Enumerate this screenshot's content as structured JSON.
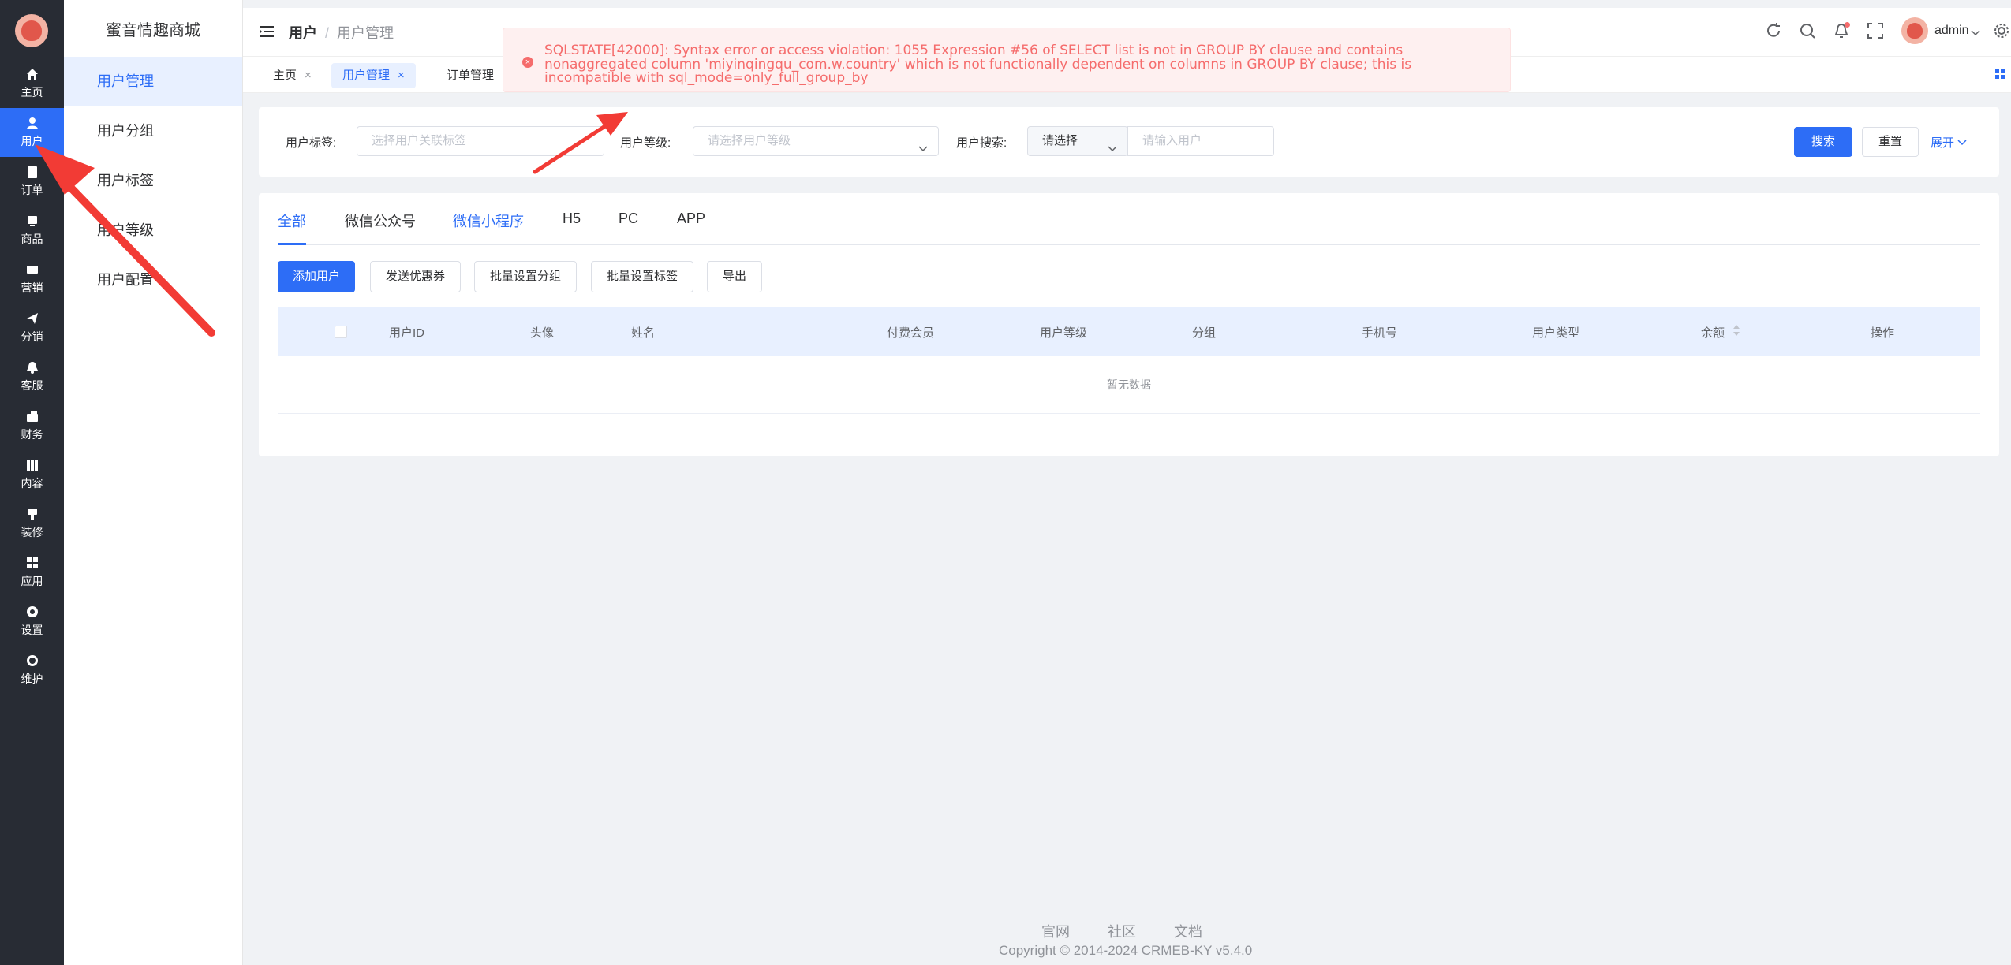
{
  "rail": {
    "items": [
      {
        "label": "主页",
        "icon": "home-icon"
      },
      {
        "label": "用户",
        "icon": "user-icon",
        "active": true
      },
      {
        "label": "订单",
        "icon": "order-icon"
      },
      {
        "label": "商品",
        "icon": "goods-icon"
      },
      {
        "label": "营销",
        "icon": "marketing-icon"
      },
      {
        "label": "分销",
        "icon": "send-icon"
      },
      {
        "label": "客服",
        "icon": "bell-icon"
      },
      {
        "label": "财务",
        "icon": "finance-icon"
      },
      {
        "label": "内容",
        "icon": "content-icon"
      },
      {
        "label": "装修",
        "icon": "brush-icon"
      },
      {
        "label": "应用",
        "icon": "apps-icon"
      },
      {
        "label": "设置",
        "icon": "gear-icon"
      },
      {
        "label": "维护",
        "icon": "maintain-icon"
      }
    ]
  },
  "submenu": {
    "brand": "蜜音情趣商城",
    "items": [
      {
        "label": "用户管理",
        "active": true
      },
      {
        "label": "用户分组"
      },
      {
        "label": "用户标签"
      },
      {
        "label": "用户等级"
      },
      {
        "label": "用户配置"
      }
    ]
  },
  "header": {
    "crumb_1": "用户",
    "crumb_sep": "/",
    "crumb_2": "用户管理",
    "user": "admin"
  },
  "tabstrip": {
    "tags": [
      {
        "label": "主页",
        "close": "×"
      },
      {
        "label": "用户管理",
        "close": "×",
        "active": true
      },
      {
        "label": "订单管理"
      }
    ]
  },
  "toast": {
    "icon": "error-icon",
    "message": "SQLSTATE[42000]: Syntax error or access violation: 1055 Expression #56 of SELECT list is not in GROUP BY clause and contains nonaggregated column 'miyinqingqu_com.w.country' which is not functionally dependent on columns in GROUP BY clause; this is incompatible with sql_mode=only_full_group_by"
  },
  "filter": {
    "tag_label": "用户标签:",
    "tag_placeholder": "选择用户关联标签",
    "level_label": "用户等级:",
    "level_placeholder": "请选择用户等级",
    "search_label": "用户搜索:",
    "search_type": "请选择",
    "search_placeholder": "请输入用户",
    "search_button": "搜索",
    "reset_button": "重置",
    "expand_link": "展开"
  },
  "main": {
    "tabs": [
      "全部",
      "微信公众号",
      "微信小程序",
      "H5",
      "PC",
      "APP"
    ],
    "actions": [
      "添加用户",
      "发送优惠券",
      "批量设置分组",
      "批量设置标签",
      "导出"
    ],
    "columns": [
      "用户ID",
      "头像",
      "姓名",
      "付费会员",
      "用户等级",
      "分组",
      "手机号",
      "用户类型",
      "余额",
      "操作"
    ],
    "empty": "暂无数据"
  },
  "footer": {
    "links": [
      "官网",
      "社区",
      "文档"
    ],
    "copyright": "Copyright © 2014-2024 CRMEB-KY v5.4.0"
  },
  "colors": {
    "primary": "#2d6df6",
    "rail": "#282c34",
    "error": "#f56c6c",
    "annotation": "#f23b35"
  }
}
